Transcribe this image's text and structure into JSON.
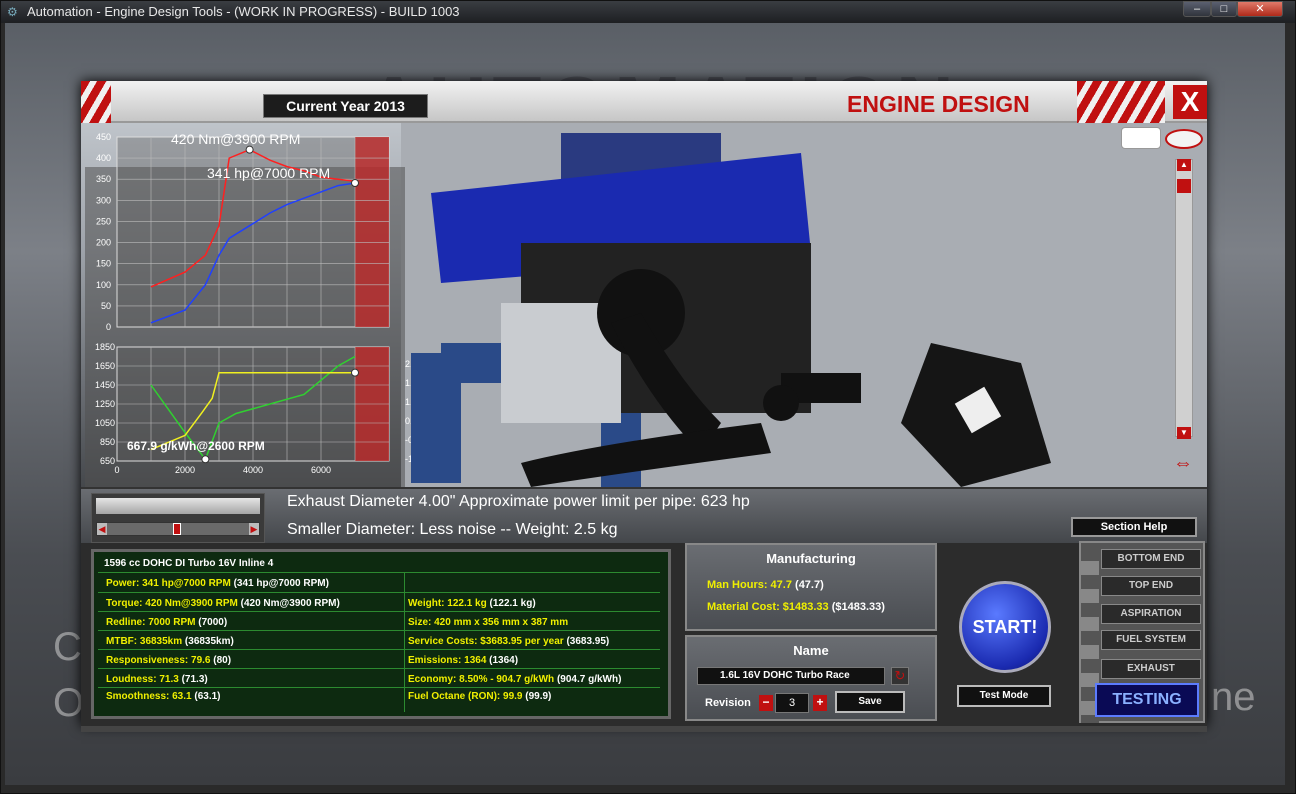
{
  "window": {
    "title": "Automation - Engine Design Tools - (WORK IN PROGRESS) - BUILD 1003",
    "min_label": "–",
    "max_label": "□",
    "close_label": "✕"
  },
  "background": {
    "logo_text": "AUTOMATION",
    "left_word": "C\nO",
    "right_word": "ne"
  },
  "header": {
    "current_year": "Current Year 2013",
    "title": "ENGINE DESIGN",
    "close_label": "X"
  },
  "graph_top": {
    "peak_torque_label": "420 Nm@3900 RPM",
    "peak_power_label": "341 hp@7000 RPM",
    "y_ticks": [
      "450",
      "400",
      "350",
      "300",
      "250",
      "200",
      "150",
      "100",
      "50",
      "0"
    ]
  },
  "graph_bottom": {
    "economy_label": "667.9 g/kWh@2600 RPM",
    "y_ticks_left": [
      "1850",
      "1650",
      "1450",
      "1250",
      "1050",
      "850",
      "650"
    ],
    "y_ticks_right": [
      "2.3",
      "1.7",
      "1.0",
      "0.3",
      "-0.3",
      "-1.0"
    ],
    "x_ticks": [
      "0",
      "2000",
      "4000",
      "6000"
    ]
  },
  "chart_data": {
    "type": "line",
    "series": [
      {
        "name": "torque",
        "color": "#ff2020",
        "x": [
          1000,
          2000,
          2600,
          3000,
          3300,
          3900,
          4500,
          5000,
          5500,
          6000,
          6500,
          7000
        ],
        "y": [
          95,
          130,
          170,
          240,
          400,
          420,
          395,
          380,
          370,
          355,
          350,
          345
        ]
      },
      {
        "name": "power",
        "color": "#2040ff",
        "x": [
          1000,
          2000,
          2600,
          3000,
          3300,
          3900,
          4500,
          5000,
          5500,
          6000,
          6500,
          7000
        ],
        "y": [
          10,
          40,
          100,
          170,
          210,
          240,
          270,
          290,
          305,
          320,
          335,
          341
        ]
      },
      {
        "name": "economy",
        "color": "#30d030",
        "x": [
          1000,
          1500,
          2000,
          2600,
          3000,
          3500,
          4500,
          5500,
          6500,
          7000
        ],
        "y": [
          1450,
          1200,
          950,
          668,
          1050,
          1150,
          1250,
          1350,
          1650,
          1750
        ]
      },
      {
        "name": "boost",
        "color": "#f0f020",
        "x": [
          1000,
          2000,
          2500,
          2800,
          3000,
          3500,
          5000,
          6500,
          7000
        ],
        "y": [
          -1.0,
          -0.5,
          0.3,
          0.8,
          1.7,
          1.7,
          1.7,
          1.7,
          1.7
        ]
      }
    ]
  },
  "info": {
    "line1": "Exhaust Diameter 4.00\"     Approximate power limit per pipe: 623 hp",
    "line2": "Smaller Diameter: Less noise -- Weight: 2.5 kg",
    "section_help": "Section Help"
  },
  "stats": {
    "title": "1596 cc DOHC DI Turbo 16V Inline 4",
    "left": [
      {
        "label": "Power: 341 hp@7000 RPM",
        "prev": "(341 hp@7000 RPM)"
      },
      {
        "label": "Torque: 420 Nm@3900 RPM",
        "prev": "(420 Nm@3900 RPM)"
      },
      {
        "label": "Redline: 7000 RPM",
        "prev": "(7000)"
      },
      {
        "label": "MTBF: 36835km",
        "prev": "(36835km)"
      },
      {
        "label": "Responsiveness: 79.6",
        "prev": "(80)"
      },
      {
        "label": "Loudness: 71.3",
        "prev": "(71.3)"
      },
      {
        "label": "Smoothness: 63.1",
        "prev": "(63.1)"
      }
    ],
    "right": [
      {
        "label": "Weight: 122.1 kg",
        "prev": "(122.1 kg)"
      },
      {
        "label": "Size: 420 mm x 356 mm x 387 mm",
        "prev": ""
      },
      {
        "label": "Service Costs: $3683.95 per year",
        "prev": "(3683.95)"
      },
      {
        "label": "Emissions: 1364",
        "prev": "(1364)"
      },
      {
        "label": "Economy: 8.50% - 904.7 g/kWh",
        "prev": "(904.7 g/kWh)"
      },
      {
        "label": "Fuel Octane (RON): 99.9",
        "prev": "(99.9)"
      }
    ]
  },
  "manufacturing": {
    "title": "Manufacturing",
    "man_hours": "Man Hours: 47.7",
    "man_hours_prev": "(47.7)",
    "material_cost": "Material Cost: $1483.33",
    "material_cost_prev": "($1483.33)"
  },
  "name_panel": {
    "title": "Name",
    "engine_name": "1.6L 16V DOHC Turbo Race",
    "revision_label": "Revision",
    "revision_value": "3",
    "save_label": "Save"
  },
  "actions": {
    "start_label": "START!",
    "test_mode_label": "Test Mode"
  },
  "sections": {
    "items": [
      "BOTTOM END",
      "TOP END",
      "ASPIRATION",
      "FUEL SYSTEM",
      "EXHAUST"
    ],
    "testing_label": "TESTING"
  }
}
